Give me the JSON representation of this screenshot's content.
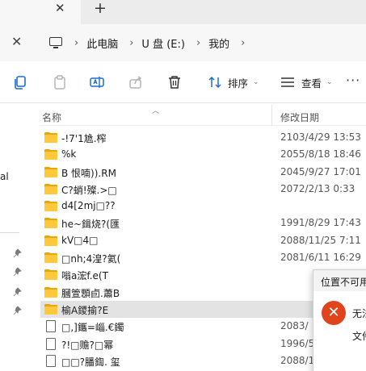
{
  "tabstrip": {
    "close_glyph": "✕",
    "new_tab_glyph": "+"
  },
  "address": {
    "breadcrumbs": [
      "此电脑",
      "U 盘 (E:)",
      "我的"
    ],
    "separator": "›"
  },
  "toolbar": {
    "sort_label": "排序",
    "view_label": "查看",
    "more_label": "···"
  },
  "navpane": {
    "visible_text": "al"
  },
  "columns": {
    "name": "名称",
    "date": "修改日期"
  },
  "files": [
    {
      "type": "folder",
      "name": "-!7'1尯.榨",
      "date": "2103/4/29 13:53"
    },
    {
      "type": "folder",
      "name": "%k",
      "date": "2055/8/18 18:46"
    },
    {
      "type": "folder",
      "name": "B 恨喃)).RM",
      "date": "2045/9/27 17:01"
    },
    {
      "type": "folder",
      "name": "C?蛸!殩.>□",
      "date": "2072/2/13 0:33"
    },
    {
      "type": "folder",
      "name": "d4[2mj□??",
      "date": ""
    },
    {
      "type": "folder",
      "name": "he~鍓烧?(匯",
      "date": "1991/8/29 17:43"
    },
    {
      "type": "folder",
      "name": "kV□4□",
      "date": "2088/11/25 7:11"
    },
    {
      "type": "folder",
      "name": "□nh;4湟?氦(",
      "date": "2081/6/11 16:29"
    },
    {
      "type": "folder",
      "name": "嗡a浤f.e(T",
      "date": ""
    },
    {
      "type": "folder",
      "name": "膕箮顋卣.蕭B",
      "date": ""
    },
    {
      "type": "folder",
      "name": "榆A鑁揄?E",
      "date": "",
      "selected": true
    },
    {
      "type": "file",
      "name": "□,]鑴=崰.€鐲",
      "date": "2083/"
    },
    {
      "type": "file",
      "name": "?!□赡?□幂",
      "date": "1996/5"
    },
    {
      "type": "file",
      "name": "□□?膰鍧. 玺",
      "date": "2088/1"
    }
  ],
  "dialog": {
    "title": "位置不可用",
    "message_line1": "无法",
    "message_line2": "文件",
    "error_glyph": "✕",
    "error_color": "#e0441c"
  },
  "colors": {
    "folder": "#ffc83d",
    "selection": "#e3e3e3",
    "accent": "#0067c0"
  }
}
